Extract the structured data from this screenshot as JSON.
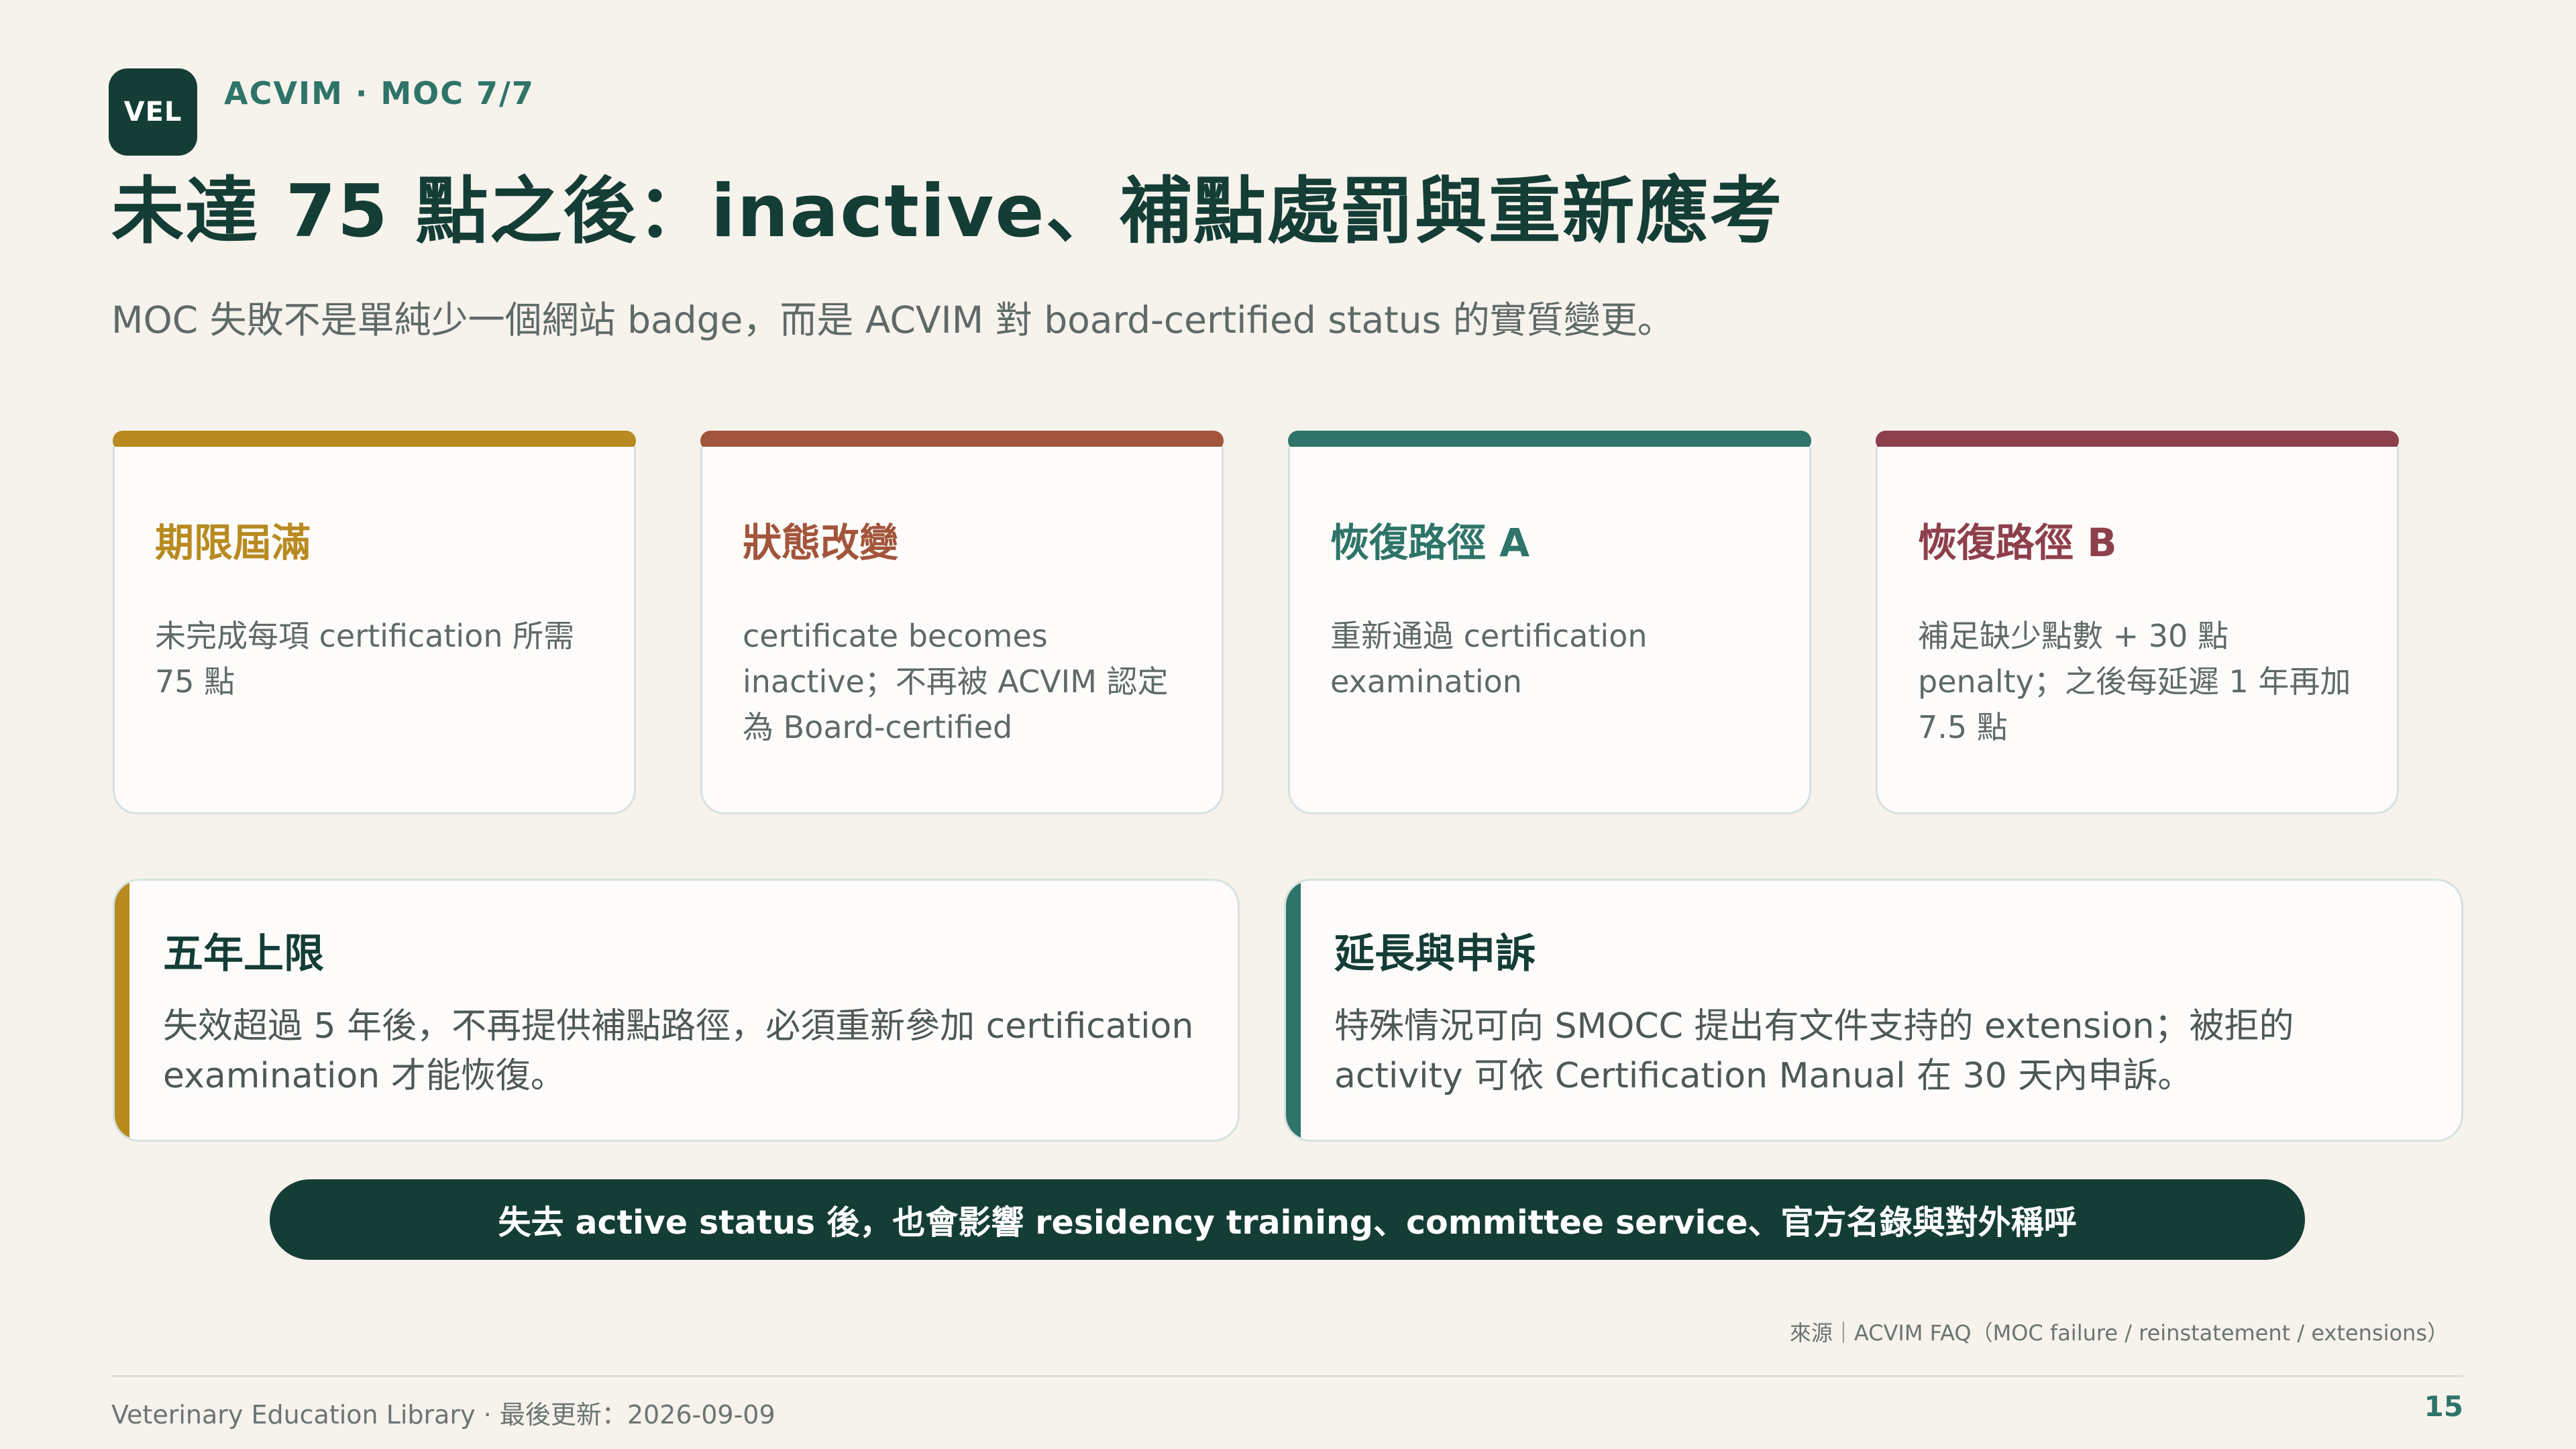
{
  "header": {
    "badge": "VEL",
    "breadcrumb": "ACVIM · MOC 7/7",
    "title": "未達 75 點之後：inactive、補點處罰與重新應考",
    "subtitle": "MOC 失敗不是單純少一個網站 badge，而是 ACVIM 對 board-certified status 的實質變更。"
  },
  "cards": [
    {
      "title": "期限屆滿",
      "text": "未完成每項 certification 所需 75 點",
      "color": "#b88a20"
    },
    {
      "title": "狀態改變",
      "text": "certificate becomes inactive；不再被 ACVIM 認定為 Board-certified",
      "color": "#a3553b"
    },
    {
      "title": "恢復路徑 A",
      "text": "重新通過 certification examination",
      "color": "#2e7468"
    },
    {
      "title": "恢復路徑 B",
      "text": "補足缺少點數 + 30 點 penalty；之後每延遲 1 年再加 7.5 點",
      "color": "#8e3f4c"
    }
  ],
  "panels": [
    {
      "title": "五年上限",
      "text": "失效超過 5 年後，不再提供補點路徑，必須重新參加 certification examination 才能恢復。",
      "color": "#b88a20"
    },
    {
      "title": "延長與申訴",
      "text": "特殊情況可向 SMOCC 提出有文件支持的 extension；被拒的 activity 可依 Certification Manual 在 30 天內申訴。",
      "color": "#2e7468"
    }
  ],
  "banner": "失去 active status 後，也會影響 residency training、committee service、官方名錄與對外稱呼",
  "source": "來源｜ACVIM FAQ（MOC failure / reinstatement / extensions）",
  "footer": {
    "text": "Veterinary Education Library · 最後更新：2026-09-09",
    "page": "15"
  }
}
